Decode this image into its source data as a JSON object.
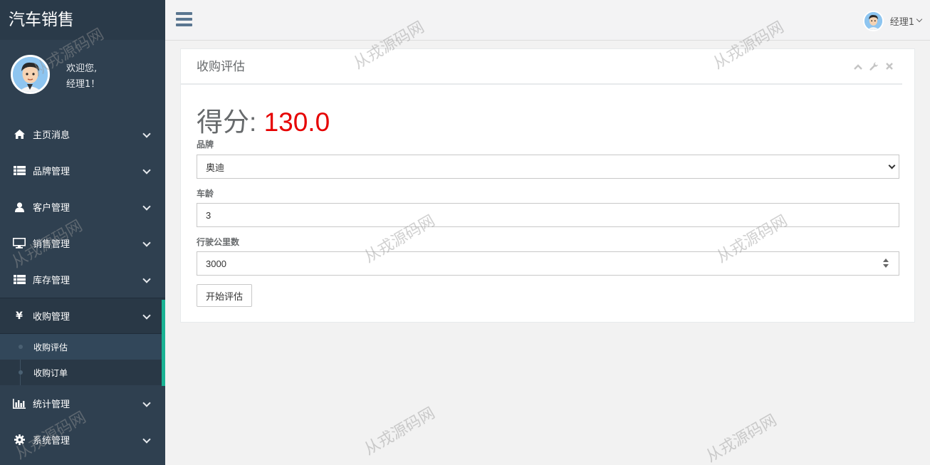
{
  "app": {
    "brand": "汽车销售"
  },
  "profile": {
    "welcome_line1": "欢迎您,",
    "welcome_line2": "经理1！"
  },
  "nav": {
    "items": [
      {
        "label": "主页消息",
        "icon": "home-icon"
      },
      {
        "label": "品牌管理",
        "icon": "list-icon"
      },
      {
        "label": "客户管理",
        "icon": "user-icon"
      },
      {
        "label": "销售管理",
        "icon": "monitor-icon"
      },
      {
        "label": "库存管理",
        "icon": "list-icon"
      },
      {
        "label": "收购管理",
        "icon": "yen-icon"
      },
      {
        "label": "统计管理",
        "icon": "bar-chart-icon"
      },
      {
        "label": "系统管理",
        "icon": "gear-icon"
      }
    ],
    "sub_items": [
      {
        "label": "收购评估"
      },
      {
        "label": "收购订单"
      }
    ]
  },
  "topbar": {
    "user_name": "经理1"
  },
  "panel": {
    "title": "收购评估",
    "score_label": "得分: ",
    "score_value": "130.0",
    "brand_label": "品牌",
    "brand_value": "奥迪",
    "age_label": "车龄",
    "age_value": "3",
    "mileage_label": "行驶公里数",
    "mileage_value": "3000",
    "submit_label": "开始评估"
  },
  "watermark": {
    "text": "从戎源码网"
  },
  "colors": {
    "sidebar": "#2f4050",
    "accent": "#1ab394",
    "score": "#e60000"
  }
}
